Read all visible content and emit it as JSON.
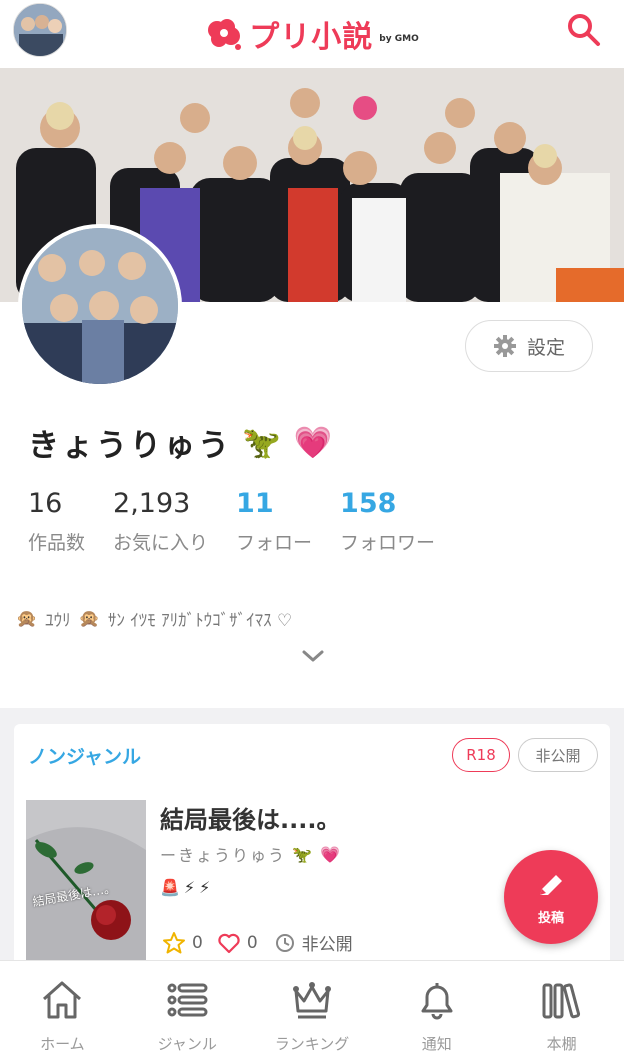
{
  "header": {
    "logo_text": "プリ小説",
    "logo_by": "by GMO"
  },
  "profile": {
    "settings_label": "設定",
    "name": "きょうりゅう",
    "name_emojis": [
      "🦖",
      "💗"
    ],
    "stats": [
      {
        "value": "16",
        "label": "作品数"
      },
      {
        "value": "2,193",
        "label": "お気に入り"
      },
      {
        "value": "11",
        "label": "フォロー"
      },
      {
        "value": "158",
        "label": "フォロワー"
      }
    ],
    "bio_prefix_emoji": "🙊",
    "bio_text": "ﾕｳﾘ",
    "bio_mid_emoji": "🙊",
    "bio_text2": "ｻﾝ ｲﾂﾓ ｱﾘｶﾞﾄｳｺﾞｻﾞｲﾏｽ ♡"
  },
  "work": {
    "genre": "ノンジャンル",
    "tags": [
      "R18",
      "非公開"
    ],
    "thumb_text": "結局最後は…。",
    "title": "結局最後は....。",
    "author": "ーきょうりゅう",
    "author_emojis": [
      "🦖",
      "💗"
    ],
    "description_emojis": [
      "🚨",
      "⚡",
      "⚡"
    ],
    "stars": "0",
    "likes": "0",
    "status": "非公開"
  },
  "fab": {
    "label": "投稿"
  },
  "tabs": [
    {
      "label": "ホーム",
      "icon": "home-icon"
    },
    {
      "label": "ジャンル",
      "icon": "list-icon"
    },
    {
      "label": "ランキング",
      "icon": "crown-icon"
    },
    {
      "label": "通知",
      "icon": "bell-icon"
    },
    {
      "label": "本棚",
      "icon": "bookshelf-icon"
    }
  ],
  "colors": {
    "brand": "#ee3b58",
    "accent_blue": "#36a7e3"
  }
}
